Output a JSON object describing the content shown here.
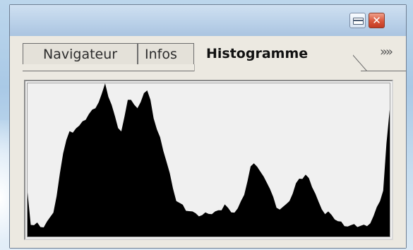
{
  "window": {
    "minimize_glyph": "—",
    "close_glyph": "✕"
  },
  "tabs": [
    {
      "label": "Navigateur",
      "active": false
    },
    {
      "label": "Infos",
      "active": false
    },
    {
      "label": "Histogramme",
      "active": true
    }
  ],
  "more_glyph": "»",
  "colors": {
    "histogram_fill": "#000000",
    "histogram_bg": "#f0f0f0"
  },
  "histogram": {
    "levels": [
      0.3,
      0.08,
      0.07,
      0.08,
      0.07,
      0.06,
      0.09,
      0.14,
      0.16,
      0.26,
      0.4,
      0.55,
      0.63,
      0.68,
      0.69,
      0.71,
      0.72,
      0.74,
      0.77,
      0.8,
      0.82,
      0.85,
      0.88,
      0.93,
      0.99,
      0.92,
      0.86,
      0.78,
      0.72,
      0.69,
      0.78,
      0.88,
      0.9,
      0.86,
      0.83,
      0.89,
      0.94,
      0.95,
      0.88,
      0.78,
      0.7,
      0.64,
      0.57,
      0.49,
      0.41,
      0.3,
      0.24,
      0.22,
      0.2,
      0.18,
      0.17,
      0.16,
      0.14,
      0.14,
      0.14,
      0.15,
      0.16,
      0.15,
      0.16,
      0.16,
      0.18,
      0.21,
      0.18,
      0.17,
      0.16,
      0.18,
      0.22,
      0.28,
      0.36,
      0.45,
      0.49,
      0.46,
      0.42,
      0.38,
      0.36,
      0.31,
      0.25,
      0.2,
      0.18,
      0.19,
      0.2,
      0.24,
      0.28,
      0.34,
      0.39,
      0.38,
      0.4,
      0.37,
      0.33,
      0.28,
      0.22,
      0.19,
      0.15,
      0.16,
      0.13,
      0.12,
      0.1,
      0.09,
      0.08,
      0.07,
      0.07,
      0.07,
      0.07,
      0.07,
      0.07,
      0.08,
      0.09,
      0.13,
      0.18,
      0.24,
      0.3,
      0.6,
      0.84
    ]
  }
}
